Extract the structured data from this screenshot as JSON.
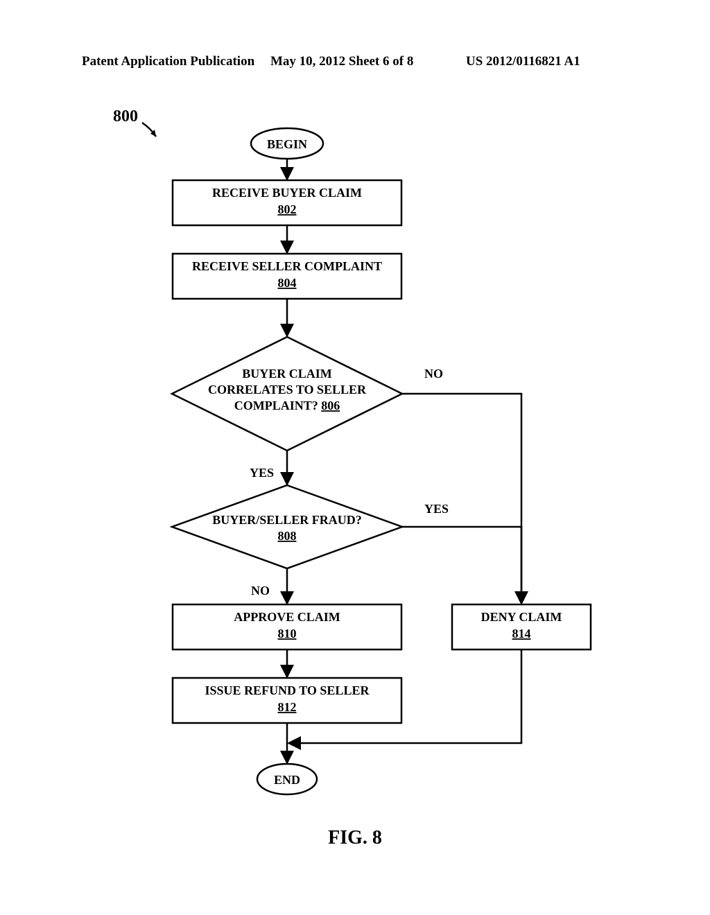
{
  "header": {
    "left": "Patent Application Publication",
    "center": "May 10, 2012  Sheet 6 of 8",
    "right": "US 2012/0116821 A1"
  },
  "ref_label": "800",
  "figure_label": "FIG. 8",
  "nodes": {
    "begin": "BEGIN",
    "end": "END",
    "step_802": {
      "text": "RECEIVE BUYER CLAIM",
      "ref": "802"
    },
    "step_804": {
      "text": "RECEIVE SELLER COMPLAINT",
      "ref": "804"
    },
    "dec_806_l1": "BUYER CLAIM",
    "dec_806_l2": "CORRELATES TO SELLER",
    "dec_806_l3": "COMPLAINT?",
    "dec_806_ref": "806",
    "dec_808_l1": "BUYER/SELLER FRAUD?",
    "dec_808_ref": "808",
    "step_810": {
      "text": "APPROVE CLAIM",
      "ref": "810"
    },
    "step_812": {
      "text": "ISSUE REFUND TO SELLER",
      "ref": "812"
    },
    "step_814": {
      "text": "DENY CLAIM",
      "ref": "814"
    }
  },
  "branches": {
    "yes": "YES",
    "no": "NO"
  }
}
